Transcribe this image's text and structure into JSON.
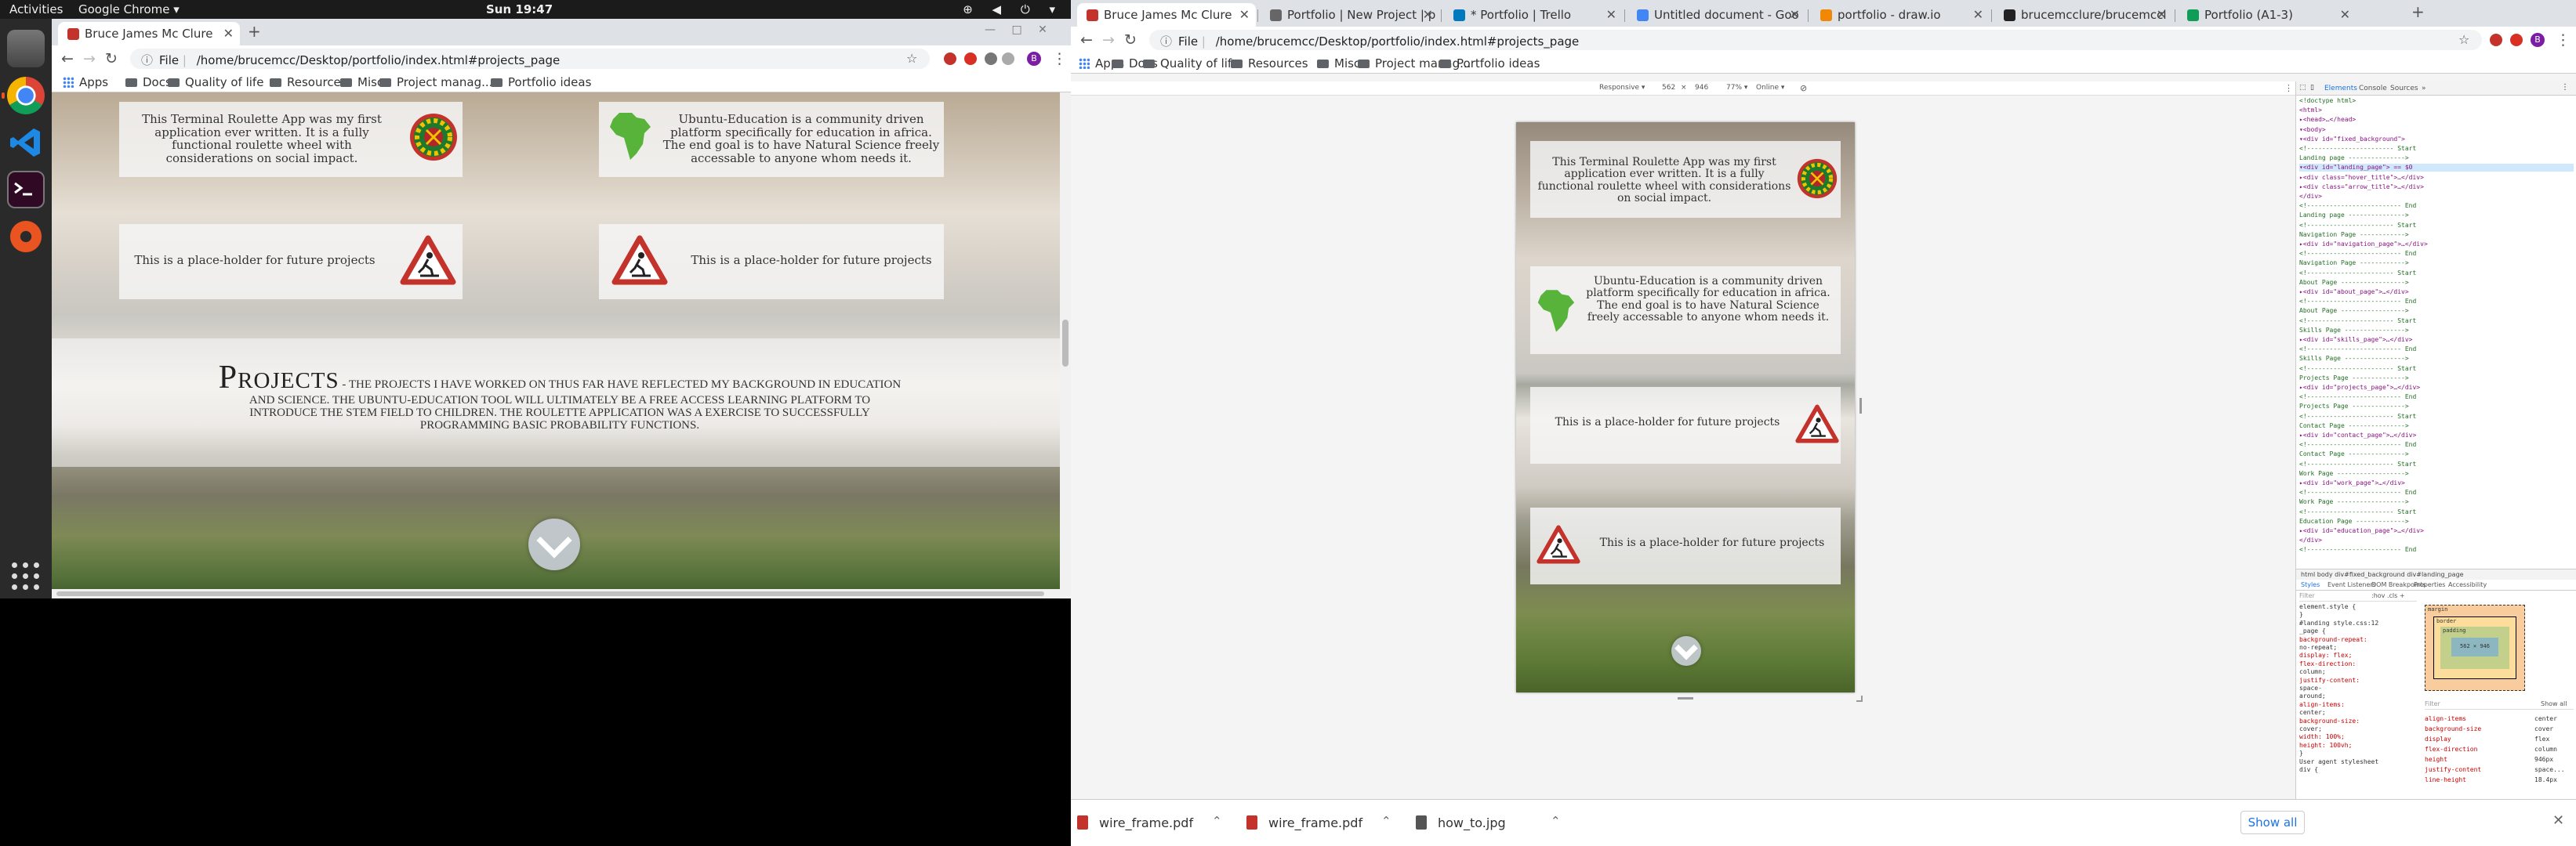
{
  "gnome": {
    "activities": "Activities",
    "app_name": "Google Chrome ▾",
    "clock": "Sun 19:47",
    "tray": "⊕ ◀ ⏻ ▾"
  },
  "colors": {
    "accent": "#e95420",
    "chrome_blue": "#1a73e8",
    "folder": "#5f6368",
    "warning_red": "#c3332b",
    "africa_green": "#57b339"
  },
  "left_browser": {
    "tab_title": "Bruce James Mc Clure",
    "new_tab": "+",
    "url_info": "File",
    "url": "/home/brucemcc/Desktop/portfolio/index.html#projects_page",
    "window_controls": "— □ ✕",
    "bookmarks": [
      {
        "label": "Apps",
        "kind": "apps"
      },
      {
        "label": "Docs",
        "kind": "folder"
      },
      {
        "label": "Quality of life",
        "kind": "folder"
      },
      {
        "label": "Resources",
        "kind": "folder"
      },
      {
        "label": "Misc",
        "kind": "folder"
      },
      {
        "label": "Project manag...",
        "kind": "folder"
      },
      {
        "label": "Portfolio ideas",
        "kind": "folder"
      }
    ],
    "cards": [
      {
        "text": "This Terminal Roulette App was my first application ever written. It is a fully functional roulette wheel with considerations on social impact.",
        "icon": "roulette-icon"
      },
      {
        "text": "Ubuntu-Education is a community driven platform specifically for education in africa. The end goal is to have Natural Science freely accessable to anyone whom needs it.",
        "icon": "africa-map-icon"
      },
      {
        "text": "This is a place-holder for future projects",
        "icon": "roadwork-icon"
      },
      {
        "text": "This is a place-holder for future projects",
        "icon": "roadwork-icon"
      }
    ],
    "projects": {
      "title": "Projects",
      "text": "- The projects I have worked on thus far have reflected my background in education and science. The Ubuntu-Education tool will ultimately be a free access learning platform to introduce the STEM field to children. The roulette application was a exercise to successfully programming basic probability functions."
    }
  },
  "right_browser": {
    "tabs": [
      {
        "title": "Bruce James Mc Clure",
        "fav": "#c3332b",
        "active": true
      },
      {
        "title": "Portfolio | New Project | p",
        "fav": "#666666"
      },
      {
        "title": "* Portfolio | Trello",
        "fav": "#0079bf"
      },
      {
        "title": "Untitled document - Goo",
        "fav": "#4285f4"
      },
      {
        "title": "portfolio - draw.io",
        "fav": "#f08705"
      },
      {
        "title": "brucemcclure/brucemccl",
        "fav": "#222222"
      },
      {
        "title": "Portfolio (A1-3)",
        "fav": "#0f9d58"
      }
    ],
    "new_tab": "+",
    "url_info": "File",
    "url": "/home/brucemcc/Desktop/portfolio/index.html#projects_page",
    "bookmarks": [
      {
        "label": "Apps",
        "kind": "apps"
      },
      {
        "label": "Docs",
        "kind": "folder"
      },
      {
        "label": "Quality of life",
        "kind": "folder"
      },
      {
        "label": "Resources",
        "kind": "folder"
      },
      {
        "label": "Misc",
        "kind": "folder"
      },
      {
        "label": "Project manag...",
        "kind": "folder"
      },
      {
        "label": "Portfolio ideas",
        "kind": "folder"
      }
    ],
    "device_toolbar": {
      "device": "Responsive ▾",
      "width": "562",
      "times": "×",
      "height": "946",
      "zoom": "77% ▾",
      "network": "Online ▾"
    },
    "mobile_cards": [
      {
        "text": "This Terminal Roulette App was my first application ever written. It is a fully functional roulette wheel with considerations on social impact.",
        "icon": "roulette-icon"
      },
      {
        "text": "Ubuntu-Education is a community driven platform specifically for education in africa. The end goal is to have Natural Science freely accessable to anyone whom needs it.",
        "icon": "africa-map-icon"
      },
      {
        "text": "This is a place-holder for future projects",
        "icon": "roadwork-icon"
      },
      {
        "text": "This is a place-holder for future projects",
        "icon": "roadwork-icon"
      }
    ],
    "devtools": {
      "tabs": [
        "Elements",
        "Console",
        "Sources",
        "»"
      ],
      "dom_lines": [
        {
          "text": "<!doctype html>",
          "kind": "com"
        },
        {
          "text": "<html>",
          "kind": "tag"
        },
        {
          "text": "▸<head>…</head>",
          "kind": "tag"
        },
        {
          "text": "▾<body>",
          "kind": "tag"
        },
        {
          "text": " ▾<div id=\"fixed_background\">",
          "kind": "tag"
        },
        {
          "text": "   <!----------------------- Start",
          "kind": "com"
        },
        {
          "text": "   Landing page --------------->",
          "kind": "com"
        },
        {
          "text": "  ▾<div id=\"landing_page\"> == $0",
          "kind": "sel"
        },
        {
          "text": "    ▸<div class=\"hover_title\">…</div>",
          "kind": "tag"
        },
        {
          "text": "    ▸<div class=\"arrow_title\">…</div>",
          "kind": "tag"
        },
        {
          "text": "   </div>",
          "kind": "tag"
        },
        {
          "text": "   <!------------------------- End",
          "kind": "com"
        },
        {
          "text": "   Landing page --------------->",
          "kind": "com"
        },
        {
          "text": "   <!----------------------- Start",
          "kind": "com"
        },
        {
          "text": "   Navigation Page ------------>",
          "kind": "com"
        },
        {
          "text": "  ▸<div id=\"navigation_page\">…</div>",
          "kind": "tag"
        },
        {
          "text": "   <!------------------------- End",
          "kind": "com"
        },
        {
          "text": "   Navigation Page ------------>",
          "kind": "com"
        },
        {
          "text": "   <!----------------------- Start",
          "kind": "com"
        },
        {
          "text": "   About Page ----------------->",
          "kind": "com"
        },
        {
          "text": "  ▸<div id=\"about_page\">…</div>",
          "kind": "tag"
        },
        {
          "text": "   <!------------------------- End",
          "kind": "com"
        },
        {
          "text": "   About Page ----------------->",
          "kind": "com"
        },
        {
          "text": "   <!----------------------- Start",
          "kind": "com"
        },
        {
          "text": "   Skills Page ---------------->",
          "kind": "com"
        },
        {
          "text": "  ▸<div id=\"skills_page\">…</div>",
          "kind": "tag"
        },
        {
          "text": "   <!------------------------- End",
          "kind": "com"
        },
        {
          "text": "   Skills Page ---------------->",
          "kind": "com"
        },
        {
          "text": "   <!----------------------- Start",
          "kind": "com"
        },
        {
          "text": "   Projects Page -------------->",
          "kind": "com"
        },
        {
          "text": "  ▸<div id=\"projects_page\">…</div>",
          "kind": "tag"
        },
        {
          "text": "   <!------------------------- End",
          "kind": "com"
        },
        {
          "text": "   Projects Page -------------->",
          "kind": "com"
        },
        {
          "text": "   <!----------------------- Start",
          "kind": "com"
        },
        {
          "text": "   Contact Page --------------->",
          "kind": "com"
        },
        {
          "text": "  ▸<div id=\"contact_page\">…</div>",
          "kind": "tag"
        },
        {
          "text": "   <!------------------------- End",
          "kind": "com"
        },
        {
          "text": "   Contact Page --------------->",
          "kind": "com"
        },
        {
          "text": "   <!----------------------- Start",
          "kind": "com"
        },
        {
          "text": "   Work Page ------------------>",
          "kind": "com"
        },
        {
          "text": "  ▸<div id=\"work_page\">…</div>",
          "kind": "tag"
        },
        {
          "text": "   <!------------------------- End",
          "kind": "com"
        },
        {
          "text": "   Work Page ------------------>",
          "kind": "com"
        },
        {
          "text": "   <!----------------------- Start",
          "kind": "com"
        },
        {
          "text": "   Education Page ------------->",
          "kind": "com"
        },
        {
          "text": "  ▸<div id=\"education_page\">…</div>",
          "kind": "tag"
        },
        {
          "text": "   </div>",
          "kind": "tag"
        },
        {
          "text": "   <!------------------------- End",
          "kind": "com"
        }
      ],
      "breadcrumbs": "html  body  div#fixed_background  div#landing_page",
      "subtabs": [
        "Styles",
        "Event Listeners",
        "DOM Breakpoints",
        "Properties",
        "Accessibility"
      ],
      "filter": "Filter",
      "hov_cls": ":hov  .cls  +",
      "styles": [
        "element.style {",
        "}",
        "#landing   style.css:12",
        "_page {",
        "  background-repeat:",
        "      no-repeat;",
        "  display: flex;",
        "  flex-direction:",
        "      column;",
        "  justify-content:",
        "      space-",
        "      around;",
        "  align-items:",
        "      center;",
        "  background-size:",
        "      cover;",
        "  width: 100%;",
        "  height: 100vh;",
        "}",
        "User agent stylesheet",
        "div {"
      ],
      "box_model": {
        "margin": "margin",
        "border": "border",
        "padding": "padding",
        "content": "562 × 946"
      },
      "computed_filter": "Filter",
      "show_all": "Show all",
      "computed": [
        {
          "prop": "align-items",
          "val": "center"
        },
        {
          "prop": "background-size",
          "val": "cover"
        },
        {
          "prop": "display",
          "val": "flex"
        },
        {
          "prop": "flex-direction",
          "val": "column"
        },
        {
          "prop": "height",
          "val": "946px"
        },
        {
          "prop": "justify-content",
          "val": "space..."
        },
        {
          "prop": "line-height",
          "val": "18.4px"
        }
      ]
    },
    "downloads": [
      {
        "name": "wire_frame.pdf",
        "color": "#c3332b"
      },
      {
        "name": "wire_frame.pdf",
        "color": "#c3332b"
      },
      {
        "name": "how_to.jpg",
        "color": "#555555"
      }
    ],
    "show_all": "Show all",
    "close": "✕"
  }
}
